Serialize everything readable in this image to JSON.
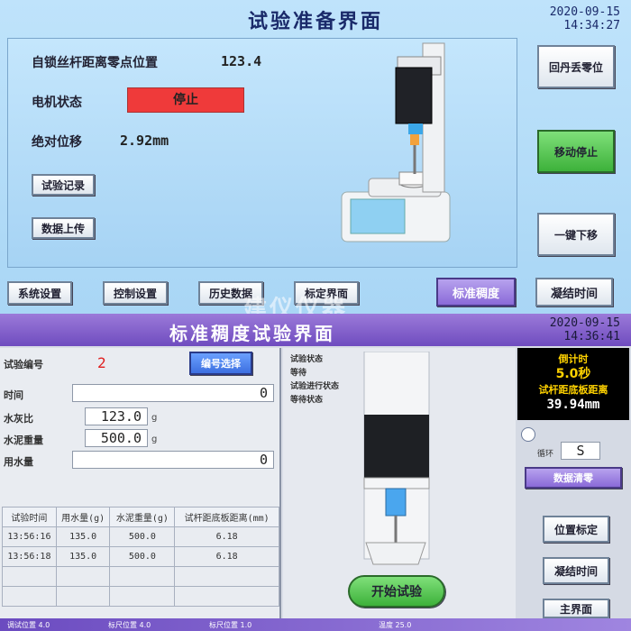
{
  "top_screen": {
    "title": "试验准备界面",
    "clock_date": "2020-09-15",
    "clock_time": "14:34:27",
    "zero_position_label": "自锁丝杆距离零点位置",
    "zero_position_value": "123.4",
    "motor_status_label": "电机状态",
    "motor_status_value": "停止",
    "abs_displacement_label": "绝对位移",
    "abs_displacement_value": "2.92mm",
    "btn_test_record": "试验记录",
    "btn_data_upload": "数据上传",
    "btn_return_zero": "回丹丢零位",
    "btn_move_up": "移动停止",
    "btn_move_down": "一键下移",
    "tabs": {
      "test_settings": "系统设置",
      "control_settings": "控制设置",
      "history_data": "历史数据",
      "calibration": "标定界面",
      "standard_consistency": "标准稠度",
      "setting_time": "凝结时间"
    },
    "colors": {
      "accent_red": "#ef3a3a",
      "accent_green": "#3db13a",
      "accent_purple": "#8a6ad8"
    }
  },
  "watermark": "建仪仪器",
  "bottom_screen": {
    "title": "标准稠度试验界面",
    "clock_date": "2020-09-15",
    "clock_time": "14:36:41",
    "sample_no_label": "试验编号",
    "sample_no_value": "2",
    "btn_select_group": "编号选择",
    "rows": [
      {
        "label": "时间",
        "value": "0",
        "unit": ""
      },
      {
        "label": "水灰比",
        "value": "123.0",
        "unit": "g"
      },
      {
        "label": "水泥重量",
        "value": "500.0",
        "unit": "g"
      },
      {
        "label": "用水量",
        "value": "0",
        "unit": ""
      }
    ],
    "table": {
      "headers": [
        "试验时间",
        "用水量(g)",
        "水泥重量(g)",
        "试杆距底板距离(mm)"
      ],
      "rows": [
        [
          "13:56:16",
          "135.0",
          "500.0",
          "6.18"
        ],
        [
          "13:56:18",
          "135.0",
          "500.0",
          "6.18"
        ]
      ]
    },
    "mid_info": [
      "试验状态",
      "等待",
      "试验进行状态",
      "等待状态"
    ],
    "btn_start_test": "开始试验",
    "timer_label": "倒计时",
    "timer_value": "5.0秒",
    "distance_label": "试杆距底板距离",
    "distance_value": "39.94mm",
    "cycle_label": "循环",
    "cycle_value": "S",
    "btn_clear": "数据清零",
    "btn_position_calibrate": "位置标定",
    "btn_setting_time": "凝结时间",
    "btn_home": "主界面",
    "status_bar": [
      "调试位置 4.0",
      "标尺位置 4.0",
      "标尺位置 1.0",
      "温度 25.0"
    ]
  }
}
